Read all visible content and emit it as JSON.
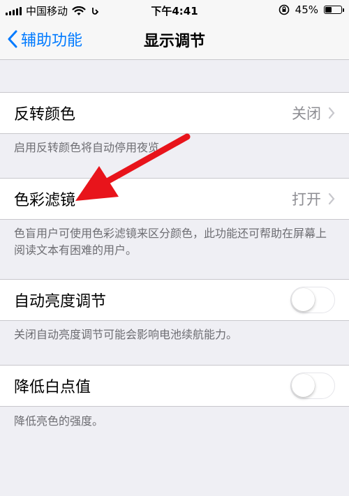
{
  "status_bar": {
    "carrier": "中国移动",
    "time": "下午4:41",
    "battery": "45%",
    "battery_level": 0.45
  },
  "nav": {
    "back_label": "辅助功能",
    "title": "显示调节"
  },
  "invert_colors": {
    "label": "反转颜色",
    "value": "关闭",
    "footer": "启用反转颜色将自动停用夜览。"
  },
  "color_filters": {
    "label": "色彩滤镜",
    "value": "打开",
    "footer": "色盲用户可使用色彩滤镜来区分颜色，此功能还可帮助在屏幕上阅读文本有困难的用户。"
  },
  "auto_brightness": {
    "label": "自动亮度调节",
    "toggle_on": false,
    "footer": "关闭自动亮度调节可能会影响电池续航能力。"
  },
  "reduce_white_point": {
    "label": "降低白点值",
    "toggle_on": false,
    "footer": "降低亮色的强度。"
  },
  "colors": {
    "accent": "#007aff",
    "annotation_arrow": "#e8141b"
  }
}
